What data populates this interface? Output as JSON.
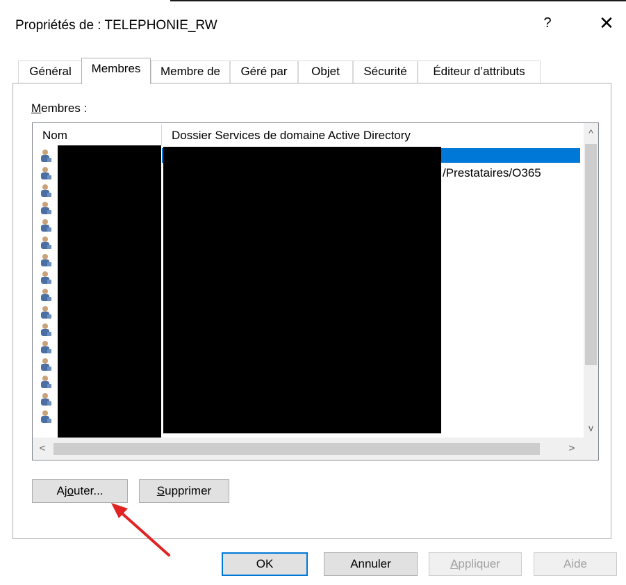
{
  "window": {
    "title": "Propriétés de : TELEPHONIE_RW",
    "help_glyph": "?",
    "close_glyph": "✕"
  },
  "tabs": [
    {
      "label": "Général"
    },
    {
      "label": "Membres",
      "active": true
    },
    {
      "label": "Membre de"
    },
    {
      "label": "Géré par"
    },
    {
      "label": "Objet"
    },
    {
      "label": "Sécurité"
    },
    {
      "label": "Éditeur d’attributs"
    }
  ],
  "members": {
    "label_underlined": "M",
    "label_rest": "embres :",
    "columns": [
      "Nom",
      "Dossier Services de domaine Active Directory"
    ],
    "rows": [
      {
        "folder": ""
      },
      {
        "folder": "/Prestataires/O365"
      },
      {
        "folder": ""
      },
      {
        "folder": ""
      },
      {
        "folder": ""
      },
      {
        "folder": ""
      },
      {
        "folder": ""
      },
      {
        "folder": ""
      },
      {
        "folder": ""
      },
      {
        "folder": ""
      },
      {
        "folder": ""
      },
      {
        "folder": ""
      },
      {
        "folder": ""
      },
      {
        "folder": ""
      },
      {
        "folder": ""
      },
      {
        "folder": ""
      }
    ],
    "selected_row": 0
  },
  "scroll_glyphs": {
    "up": "^",
    "down": "v",
    "left": "<",
    "right": ">"
  },
  "buttons": {
    "add": {
      "pre": "Aj",
      "underlined": "o",
      "post": "uter..."
    },
    "remove": {
      "underlined": "S",
      "post": "upprimer"
    },
    "ok": "OK",
    "cancel": "Annuler",
    "apply": {
      "underlined": "A",
      "post": "ppliquer"
    },
    "help": "Aide"
  },
  "colors": {
    "selection": "#0078d7",
    "annotation_arrow": "#e02424"
  }
}
